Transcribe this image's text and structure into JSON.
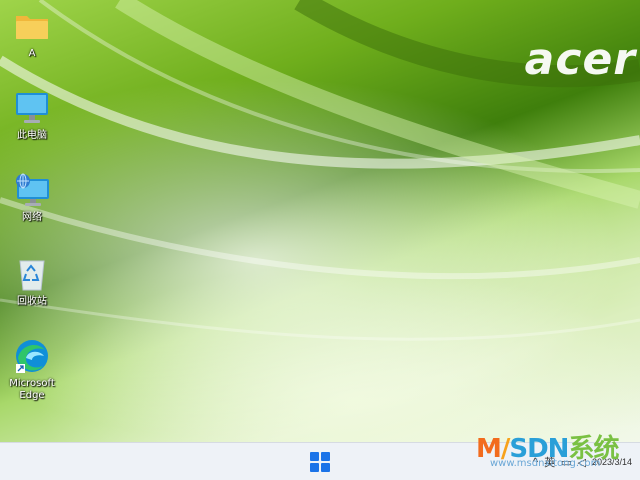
{
  "wallpaper": {
    "brand_text": "acer",
    "colors": {
      "primary": "#6fae1c",
      "dark": "#3f7f0c",
      "light": "#f2f8ea"
    }
  },
  "desktop_icons": [
    {
      "label": "A",
      "icon": "folder-icon"
    },
    {
      "label": "此电脑",
      "icon": "computer-icon"
    },
    {
      "label": "网络",
      "icon": "network-icon"
    },
    {
      "label": "回收站",
      "icon": "recycle-bin-icon"
    },
    {
      "label": "Microsoft Edge",
      "icon": "edge-icon"
    }
  ],
  "taskbar": {
    "start_icon": "windows-start-icon",
    "accent": "#1a73e8",
    "tray": {
      "chevron": "^",
      "lang": "英",
      "clock_time": "",
      "clock_date": "2023/3/14"
    }
  },
  "watermark": {
    "title_parts": [
      "M",
      "/",
      "SDN",
      "系统"
    ],
    "url": "www.msdnxitong.com"
  }
}
